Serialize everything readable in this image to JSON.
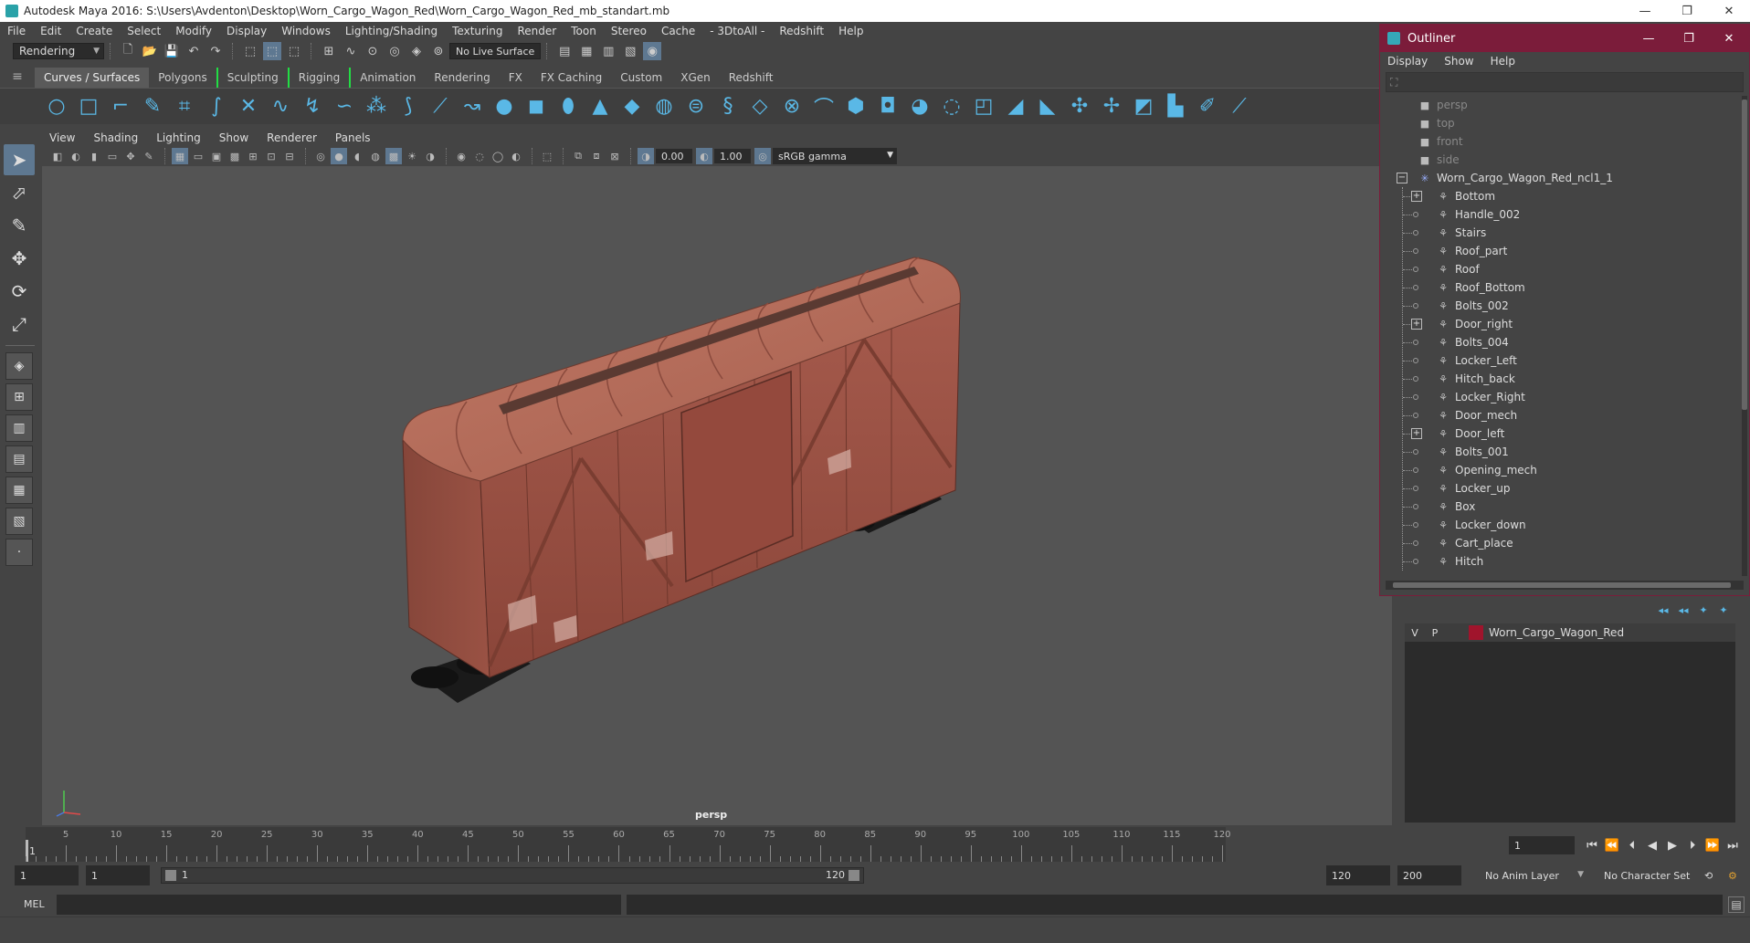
{
  "window": {
    "title": "Autodesk Maya 2016: S:\\Users\\Avdenton\\Desktop\\Worn_Cargo_Wagon_Red\\Worn_Cargo_Wagon_Red_mb_standart.mb",
    "minimize": "—",
    "maximize": "❐",
    "close": "✕"
  },
  "menubar": [
    "File",
    "Edit",
    "Create",
    "Select",
    "Modify",
    "Display",
    "Windows",
    "Lighting/Shading",
    "Texturing",
    "Render",
    "Toon",
    "Stereo",
    "Cache",
    "- 3DtoAll -",
    "Redshift",
    "Help"
  ],
  "statusline": {
    "menuset": "Rendering",
    "live_surface": "No Live Surface"
  },
  "shelf_tabs": [
    "Curves / Surfaces",
    "Polygons",
    "Sculpting",
    "Rigging",
    "Animation",
    "Rendering",
    "FX",
    "FX Caching",
    "Custom",
    "XGen",
    "Redshift"
  ],
  "panel_menu": [
    "View",
    "Shading",
    "Lighting",
    "Show",
    "Renderer",
    "Panels"
  ],
  "panel_toolbar": {
    "exposure": "0.00",
    "gamma_value": "1.00",
    "color_space": "sRGB gamma"
  },
  "viewport": {
    "camera_label": "persp"
  },
  "outliner": {
    "title": "Outliner",
    "menu": [
      "Display",
      "Show",
      "Help"
    ],
    "cameras": [
      "persp",
      "top",
      "front",
      "side"
    ],
    "root": "Worn_Cargo_Wagon_Red_ncl1_1",
    "children": [
      {
        "name": "Bottom",
        "expandable": true
      },
      {
        "name": "Handle_002",
        "expandable": false
      },
      {
        "name": "Stairs",
        "expandable": false
      },
      {
        "name": "Roof_part",
        "expandable": false
      },
      {
        "name": "Roof",
        "expandable": false
      },
      {
        "name": "Roof_Bottom",
        "expandable": false
      },
      {
        "name": "Bolts_002",
        "expandable": false
      },
      {
        "name": "Door_right",
        "expandable": true
      },
      {
        "name": "Bolts_004",
        "expandable": false
      },
      {
        "name": "Locker_Left",
        "expandable": false
      },
      {
        "name": "Hitch_back",
        "expandable": false
      },
      {
        "name": "Locker_Right",
        "expandable": false
      },
      {
        "name": "Door_mech",
        "expandable": false
      },
      {
        "name": "Door_left",
        "expandable": true
      },
      {
        "name": "Bolts_001",
        "expandable": false
      },
      {
        "name": "Opening_mech",
        "expandable": false
      },
      {
        "name": "Locker_up",
        "expandable": false
      },
      {
        "name": "Box",
        "expandable": false
      },
      {
        "name": "Locker_down",
        "expandable": false
      },
      {
        "name": "Cart_place",
        "expandable": false
      },
      {
        "name": "Hitch",
        "expandable": false
      }
    ]
  },
  "layers": [
    {
      "visible": "V",
      "playback": "P",
      "color": "#a0142c",
      "name": "Worn_Cargo_Wagon_Red"
    }
  ],
  "timeslider": {
    "tick_labels": [
      "5",
      "10",
      "15",
      "20",
      "25",
      "30",
      "35",
      "40",
      "45",
      "50",
      "55",
      "60",
      "65",
      "70",
      "75",
      "80",
      "85",
      "90",
      "95",
      "100",
      "105",
      "110",
      "115",
      "120"
    ],
    "current_frame_label": "1",
    "current_frame": "1"
  },
  "rangeslider": {
    "start": "1",
    "playback_start": "1",
    "range_start_label": "1",
    "range_end_label": "120",
    "playback_end": "120",
    "end": "200",
    "anim_layer": "No Anim Layer",
    "character_set": "No Character Set"
  },
  "cmdline": {
    "label": "MEL"
  },
  "colors": {
    "outliner_accent": "#7b1c3a",
    "shelf_icon": "#5ab8e6",
    "active_tool": "#5e7891",
    "wagon_body": "#a6584a"
  }
}
